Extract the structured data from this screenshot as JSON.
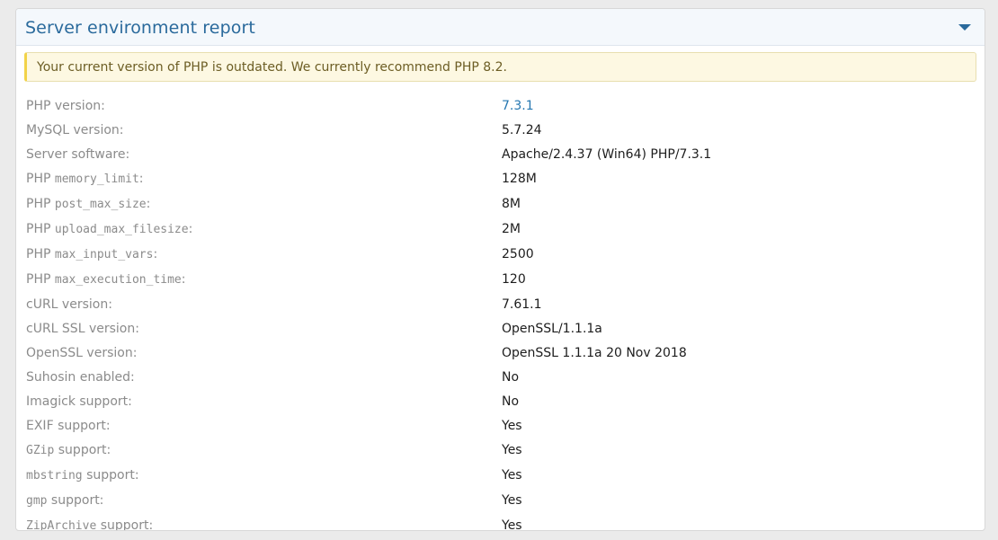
{
  "panel": {
    "title": "Server environment report",
    "toggle_icon": "triangle-down-icon",
    "accent": "#2a6a9c"
  },
  "notice": {
    "text": "Your current version of PHP is outdated. We currently recommend PHP 8.2.",
    "border_color": "#f2d348",
    "background": "#fdf8e2"
  },
  "rows": [
    {
      "prefix": "PHP version:",
      "code": "",
      "suffix": "",
      "value": "7.3.1"
    },
    {
      "prefix": "MySQL version:",
      "code": "",
      "suffix": "",
      "value": "5.7.24"
    },
    {
      "prefix": "Server software:",
      "code": "",
      "suffix": "",
      "value": "Apache/2.4.37 (Win64) PHP/7.3.1"
    },
    {
      "prefix": "PHP ",
      "code": "memory_limit",
      "suffix": ":",
      "value": "128M"
    },
    {
      "prefix": "PHP ",
      "code": "post_max_size",
      "suffix": ":",
      "value": "8M"
    },
    {
      "prefix": "PHP ",
      "code": "upload_max_filesize",
      "suffix": ":",
      "value": "2M"
    },
    {
      "prefix": "PHP ",
      "code": "max_input_vars",
      "suffix": ":",
      "value": "2500"
    },
    {
      "prefix": "PHP ",
      "code": "max_execution_time",
      "suffix": ":",
      "value": "120"
    },
    {
      "prefix": "cURL version:",
      "code": "",
      "suffix": "",
      "value": "7.61.1"
    },
    {
      "prefix": "cURL SSL version:",
      "code": "",
      "suffix": "",
      "value": "OpenSSL/1.1.1a"
    },
    {
      "prefix": "OpenSSL version:",
      "code": "",
      "suffix": "",
      "value": "OpenSSL 1.1.1a 20 Nov 2018"
    },
    {
      "prefix": "Suhosin enabled:",
      "code": "",
      "suffix": "",
      "value": "No"
    },
    {
      "prefix": "Imagick support:",
      "code": "",
      "suffix": "",
      "value": "No"
    },
    {
      "prefix": "EXIF support:",
      "code": "",
      "suffix": "",
      "value": "Yes"
    },
    {
      "prefix": "",
      "code": "GZip",
      "suffix": " support:",
      "value": "Yes"
    },
    {
      "prefix": "",
      "code": "mbstring",
      "suffix": " support:",
      "value": "Yes"
    },
    {
      "prefix": "",
      "code": "gmp",
      "suffix": " support:",
      "value": "Yes"
    },
    {
      "prefix": "",
      "code": "ZipArchive",
      "suffix": " support:",
      "value": "Yes"
    }
  ]
}
